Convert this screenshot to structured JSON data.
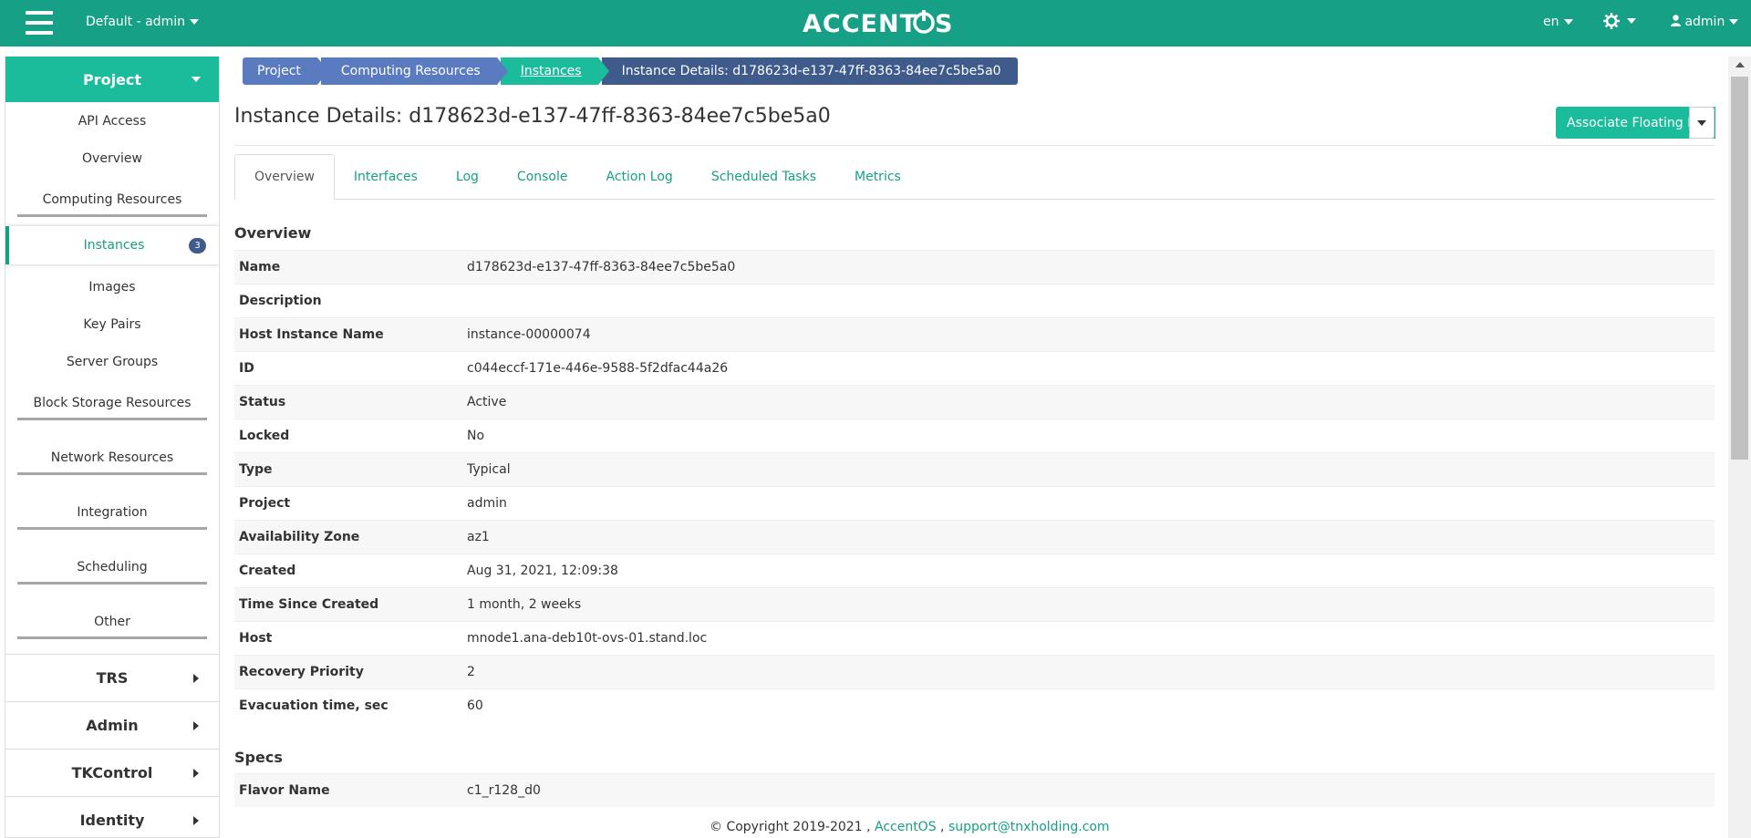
{
  "topbar": {
    "project_switch": "Default - admin",
    "logo_text": "ACCENTOS",
    "lang": "en",
    "user": "admin"
  },
  "sidebar": {
    "head": "Project",
    "links": {
      "api_access": "API Access",
      "overview": "Overview",
      "computing_resources": "Computing Resources",
      "instances": "Instances",
      "instances_count": "3",
      "images": "Images",
      "key_pairs": "Key Pairs",
      "server_groups": "Server Groups",
      "block_storage": "Block Storage Resources",
      "network_resources": "Network Resources",
      "integration": "Integration",
      "scheduling": "Scheduling",
      "other": "Other"
    },
    "sections": [
      "TRS",
      "Admin",
      "TKControl",
      "Identity"
    ]
  },
  "breadcrumb": [
    "Project",
    "Computing Resources",
    "Instances",
    "Instance Details: d178623d-e137-47ff-8363-84ee7c5be5a0"
  ],
  "title": "Instance Details: d178623d-e137-47ff-8363-84ee7c5be5a0",
  "actions": {
    "associate_fip": "Associate Floating IP"
  },
  "tabs": [
    "Overview",
    "Interfaces",
    "Log",
    "Console",
    "Action Log",
    "Scheduled Tasks",
    "Metrics"
  ],
  "overview": {
    "title": "Overview",
    "rows": [
      {
        "k": "Name",
        "v": "d178623d-e137-47ff-8363-84ee7c5be5a0"
      },
      {
        "k": "Description",
        "v": ""
      },
      {
        "k": "Host Instance Name",
        "v": "instance-00000074"
      },
      {
        "k": "ID",
        "v": "c044eccf-171e-446e-9588-5f2dfac44a26"
      },
      {
        "k": "Status",
        "v": "Active"
      },
      {
        "k": "Locked",
        "v": "No"
      },
      {
        "k": "Type",
        "v": "Typical"
      },
      {
        "k": "Project",
        "v": "admin"
      },
      {
        "k": "Availability Zone",
        "v": "az1"
      },
      {
        "k": "Created",
        "v": "Aug 31, 2021, 12:09:38"
      },
      {
        "k": "Time Since Created",
        "v": "1 month, 2 weeks"
      },
      {
        "k": "Host",
        "v": "mnode1.ana-deb10t-ovs-01.stand.loc"
      },
      {
        "k": "Recovery Priority",
        "v": "2"
      },
      {
        "k": "Evacuation time, sec",
        "v": "60"
      }
    ]
  },
  "specs": {
    "title": "Specs",
    "rows": [
      {
        "k": "Flavor Name",
        "v": "c1_r128_d0"
      }
    ]
  },
  "footer": {
    "copyright": "© Copyright 2019-2021 ,",
    "brand": "AccentOS",
    "sep": ",",
    "email": "support@tnxholding.com"
  },
  "colors": {
    "topbar": "#16a085",
    "accent": "#1abc9c",
    "crumb_blue": "#5b7bc0",
    "crumb_dark": "#3f5b8c"
  }
}
